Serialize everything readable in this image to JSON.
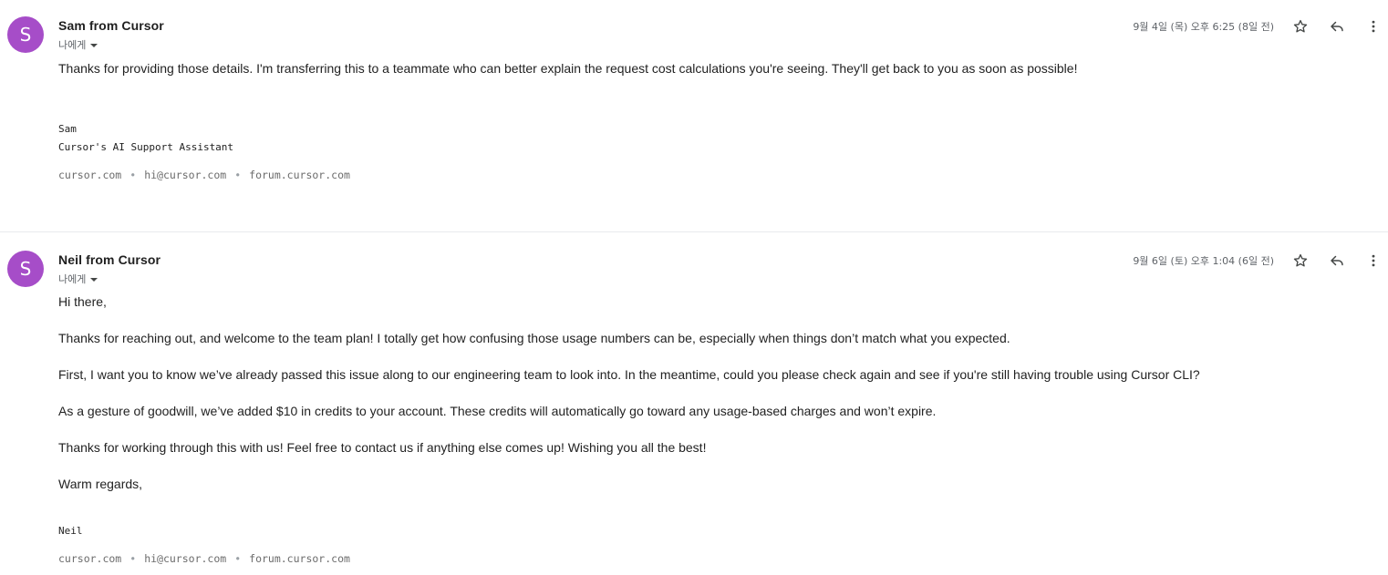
{
  "messages": [
    {
      "avatar_letter": "S",
      "avatar_color": "#a64dc8",
      "sender": "Sam from Cursor",
      "recipient": "나에게",
      "timestamp": "9월 4일 (목) 오후 6:25 (8일 전)",
      "body": [
        "Thanks for providing those details. I'm transferring this to a teammate who can better explain the request cost calculations you're seeing. They'll get back to you as soon as possible!"
      ],
      "signature": [
        "Sam",
        "Cursor's AI Support Assistant"
      ],
      "links": [
        "cursor.com",
        "hi@cursor.com",
        "forum.cursor.com"
      ],
      "link_separator": "•"
    },
    {
      "avatar_letter": "S",
      "avatar_color": "#a64dc8",
      "sender": "Neil from Cursor",
      "recipient": "나에게",
      "timestamp": "9월 6일 (토) 오후 1:04 (6일 전)",
      "body": [
        "Hi there,",
        "Thanks for reaching out, and welcome to the team plan! I totally get how confusing those usage numbers can be, especially when things don’t match what you expected.",
        "First, I want you to know we’ve already passed this issue along to our engineering team to look into. In the meantime, could you please check again and see if you're still having trouble using Cursor CLI?",
        "As a gesture of goodwill, we’ve added $10 in credits to your account. These credits will automatically go toward any usage-based charges and won’t expire.",
        "Thanks for working through this with us! Feel free to contact us if anything else comes up! Wishing you all the best!",
        "Warm regards,"
      ],
      "signature": [
        "Neil"
      ],
      "links": [
        "cursor.com",
        "hi@cursor.com",
        "forum.cursor.com"
      ],
      "link_separator": "•"
    }
  ],
  "icons": {
    "star": "star-icon",
    "reply": "reply-icon",
    "more": "more-vert-icon",
    "caret": "caret-down-icon"
  }
}
